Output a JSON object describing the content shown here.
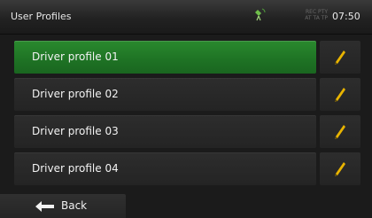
{
  "header": {
    "title": "User Profiles",
    "rec_line1": "REC PTY",
    "rec_line2": "AT TA TP",
    "clock": "07:50",
    "gps_icon": "satellite-icon"
  },
  "profiles": [
    {
      "label": "Driver profile 01",
      "selected": true
    },
    {
      "label": "Driver profile 02",
      "selected": false
    },
    {
      "label": "Driver profile 03",
      "selected": false
    },
    {
      "label": "Driver profile 04",
      "selected": false
    }
  ],
  "footer": {
    "back_label": "Back",
    "back_icon": "arrow-left-icon"
  },
  "colors": {
    "accent_green": "#1e7224",
    "pencil_yellow": "#e9b400"
  }
}
